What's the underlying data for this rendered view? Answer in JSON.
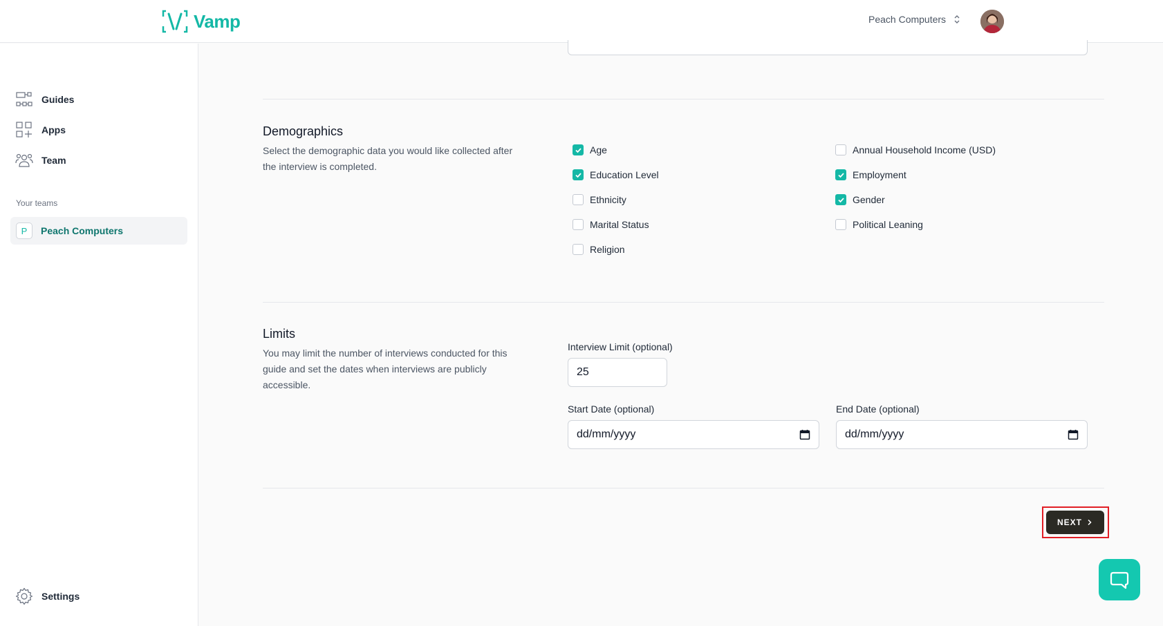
{
  "app": {
    "name": "Vamp"
  },
  "header": {
    "team_switcher": "Peach Computers"
  },
  "sidebar": {
    "items": [
      {
        "label": "Guides",
        "icon": "guides-icon"
      },
      {
        "label": "Apps",
        "icon": "apps-icon"
      },
      {
        "label": "Team",
        "icon": "team-icon"
      }
    ],
    "teams_heading": "Your teams",
    "team": {
      "letter": "P",
      "name": "Peach Computers"
    },
    "settings_label": "Settings"
  },
  "demographics": {
    "title": "Demographics",
    "description": "Select the demographic data you would like collected after the interview is completed.",
    "options": [
      {
        "label": "Age",
        "checked": true
      },
      {
        "label": "Education Level",
        "checked": true
      },
      {
        "label": "Ethnicity",
        "checked": false
      },
      {
        "label": "Marital Status",
        "checked": false
      },
      {
        "label": "Religion",
        "checked": false
      },
      {
        "label": "Annual Household Income (USD)",
        "checked": false
      },
      {
        "label": "Employment",
        "checked": true
      },
      {
        "label": "Gender",
        "checked": true
      },
      {
        "label": "Political Leaning",
        "checked": false
      }
    ]
  },
  "limits": {
    "title": "Limits",
    "description": "You may limit the number of interviews conducted for this guide and set the dates when interviews are publicly accessible.",
    "interview_limit_label": "Interview Limit (optional)",
    "interview_limit_value": "25",
    "start_date_label": "Start Date (optional)",
    "start_date_placeholder": "dd/mm/yyyy",
    "end_date_label": "End Date (optional)",
    "end_date_placeholder": "dd/mm/yyyy"
  },
  "actions": {
    "next_label": "NEXT"
  },
  "colors": {
    "accent": "#14b8a6",
    "button_dark": "#2b2a24",
    "highlight": "#e11d24"
  }
}
